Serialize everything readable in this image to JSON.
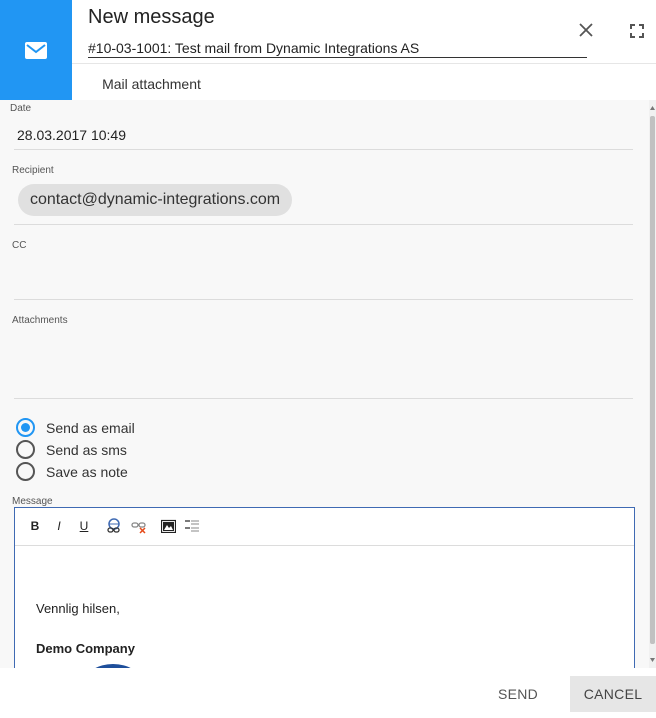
{
  "header": {
    "title": "New message",
    "subject": "#10-03-1001: Test mail from Dynamic Integrations AS",
    "mail_icon": "envelope-icon",
    "close_icon": "close-icon",
    "expand_icon": "fullscreen-icon",
    "accent_color": "#2196f3"
  },
  "tabs": [
    {
      "label": "Mail attachment"
    }
  ],
  "form": {
    "date": {
      "label": "Date",
      "value": "28.03.2017 10:49"
    },
    "recipient": {
      "label": "Recipient",
      "chip": "contact@dynamic-integrations.com"
    },
    "cc": {
      "label": "CC"
    },
    "attachments": {
      "label": "Attachments"
    },
    "send_options": [
      {
        "label": "Send as email",
        "checked": true
      },
      {
        "label": "Send as sms",
        "checked": false
      },
      {
        "label": "Save as note",
        "checked": false
      }
    ],
    "message": {
      "label": "Message",
      "toolbar": [
        {
          "label": "B",
          "icon": "bold-icon"
        },
        {
          "label": "I",
          "icon": "italic-icon"
        },
        {
          "label": "U",
          "icon": "underline-icon"
        },
        {
          "icon": "insert-link-icon"
        },
        {
          "icon": "remove-link-icon"
        },
        {
          "icon": "insert-image-icon"
        },
        {
          "icon": "format-paragraph-icon"
        }
      ],
      "greeting": "Vennlig hilsen,",
      "company": "Demo Company"
    }
  },
  "footer": {
    "send_label": "SEND",
    "cancel_label": "CANCEL"
  }
}
